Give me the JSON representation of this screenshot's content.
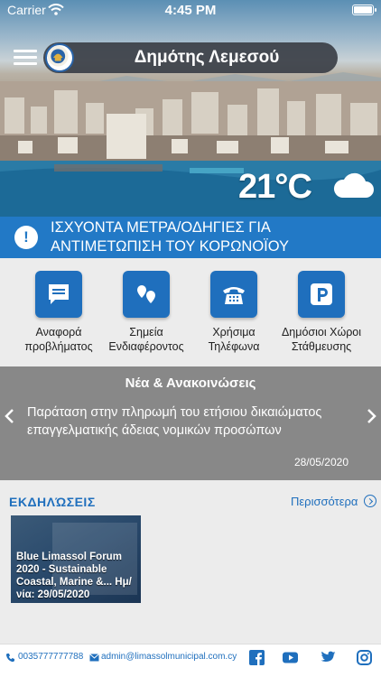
{
  "status_bar": {
    "carrier": "Carrier",
    "time": "4:45 PM"
  },
  "header": {
    "title": "Δημότης Λεμεσού"
  },
  "weather": {
    "temperature": "21°C",
    "condition_icon": "cloud-icon"
  },
  "alert": {
    "icon": "info-icon",
    "text": "ΙΣΧΥΟΝΤΑ ΜΕΤΡΑ/ΟΔΗΓΙΕΣ ΓΙΑ ΑΝΤΙΜΕΤΩΠΙΣΗ ΤΟΥ ΚΟΡΩΝΟΪΟΥ"
  },
  "actions": [
    {
      "icon": "report-message-icon",
      "label": "Αναφορά προβλήματος"
    },
    {
      "icon": "map-pins-icon",
      "label": "Σημεία Ενδιαφέροντος"
    },
    {
      "icon": "telephone-icon",
      "label": "Χρήσιμα Τηλέφωνα"
    },
    {
      "icon": "parking-icon",
      "label": "Δημόσιοι Χώροι Στάθμευσης"
    }
  ],
  "news": {
    "heading": "Νέα & Ανακοινώσεις",
    "body": "Παράταση στην πληρωμή του ετήσιου δικαιώματος επαγγελματικής άδειας νομικών προσώπων",
    "date": "28/05/2020"
  },
  "events": {
    "heading": "ΕΚΔΗΛΏΣΕΙΣ",
    "more": "Περισσότερα",
    "items": [
      {
        "text": "Blue Limassol Forum 2020 - Sustainable Coastal, Marine &... Ημ/νία: 29/05/2020"
      }
    ]
  },
  "footer": {
    "phone": "0035777777788",
    "email": "admin@limassolmunicipal.com.cy",
    "social": [
      "facebook-icon",
      "youtube-icon",
      "twitter-icon",
      "instagram-icon"
    ]
  },
  "colors": {
    "accent": "#2279c6",
    "tile": "#1f6fbd",
    "news_bg": "#888888",
    "title_pill": "#3b3f46"
  }
}
